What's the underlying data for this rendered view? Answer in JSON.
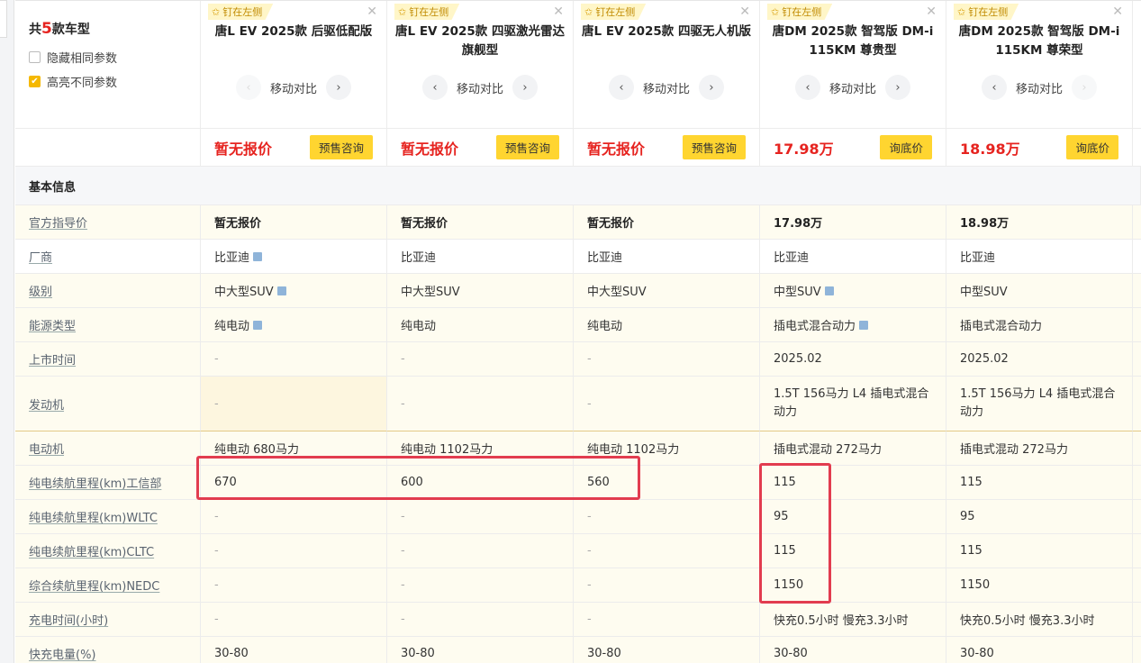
{
  "summary": {
    "count_prefix": "共",
    "count_num": "5",
    "count_suffix": "款车型",
    "opt_hide": "隐藏相同参数",
    "opt_highlight": "高亮不同参数"
  },
  "pin_label": "钉在左侧",
  "move_label": "移动对比",
  "cars": [
    {
      "name": "唐L EV 2025款 后驱低配版",
      "price": "暂无报价",
      "btn": "预售咨询"
    },
    {
      "name": "唐L EV 2025款 四驱激光雷达旗舰型",
      "price": "暂无报价",
      "btn": "预售咨询"
    },
    {
      "name": "唐L EV 2025款 四驱无人机版",
      "price": "暂无报价",
      "btn": "预售咨询"
    },
    {
      "name": "唐DM 2025款 智驾版 DM-i 115KM 尊贵型",
      "price": "17.98万",
      "btn": "询底价"
    },
    {
      "name": "唐DM 2025款 智驾版 DM-i 115KM 尊荣型",
      "price": "18.98万",
      "btn": "询底价"
    }
  ],
  "section_basic": "基本信息",
  "rows": [
    {
      "label": "官方指导价",
      "values": [
        "暂无报价",
        "暂无报价",
        "暂无报价",
        "17.98万",
        "18.98万"
      ]
    },
    {
      "label": "厂商",
      "values": [
        "比亚迪",
        "比亚迪",
        "比亚迪",
        "比亚迪",
        "比亚迪"
      ]
    },
    {
      "label": "级别",
      "values": [
        "中大型SUV",
        "中大型SUV",
        "中大型SUV",
        "中型SUV",
        "中型SUV"
      ]
    },
    {
      "label": "能源类型",
      "values": [
        "纯电动",
        "纯电动",
        "纯电动",
        "插电式混合动力",
        "插电式混合动力"
      ]
    },
    {
      "label": "上市时间",
      "values": [
        "-",
        "-",
        "-",
        "2025.02",
        "2025.02"
      ]
    },
    {
      "label": "发动机",
      "values": [
        "-",
        "-",
        "-",
        "1.5T 156马力 L4 插电式混合动力",
        "1.5T 156马力 L4 插电式混合动力"
      ]
    },
    {
      "label": "电动机",
      "values": [
        "纯电动 680马力",
        "纯电动 1102马力",
        "纯电动 1102马力",
        "插电式混动 272马力",
        "插电式混动 272马力"
      ]
    },
    {
      "label": "纯电续航里程(km)工信部",
      "values": [
        "670",
        "600",
        "560",
        "115",
        "115"
      ]
    },
    {
      "label": "纯电续航里程(km)WLTC",
      "values": [
        "-",
        "-",
        "-",
        "95",
        "95"
      ]
    },
    {
      "label": "纯电续航里程(km)CLTC",
      "values": [
        "-",
        "-",
        "-",
        "115",
        "115"
      ]
    },
    {
      "label": "综合续航里程(km)NEDC",
      "values": [
        "-",
        "-",
        "-",
        "1150",
        "1150"
      ]
    },
    {
      "label": "充电时间(小时)",
      "values": [
        "-",
        "-",
        "-",
        "快充0.5小时 慢充3.3小时",
        "快充0.5小时 慢充3.3小时"
      ]
    },
    {
      "label": "快充电量(%)",
      "values": [
        "30-80",
        "30-80",
        "30-80",
        "30-80",
        "30-80"
      ]
    }
  ],
  "colors": {
    "accent": "#ffd530",
    "price_red": "#e6231f",
    "annotation_red": "#e23c4f"
  }
}
